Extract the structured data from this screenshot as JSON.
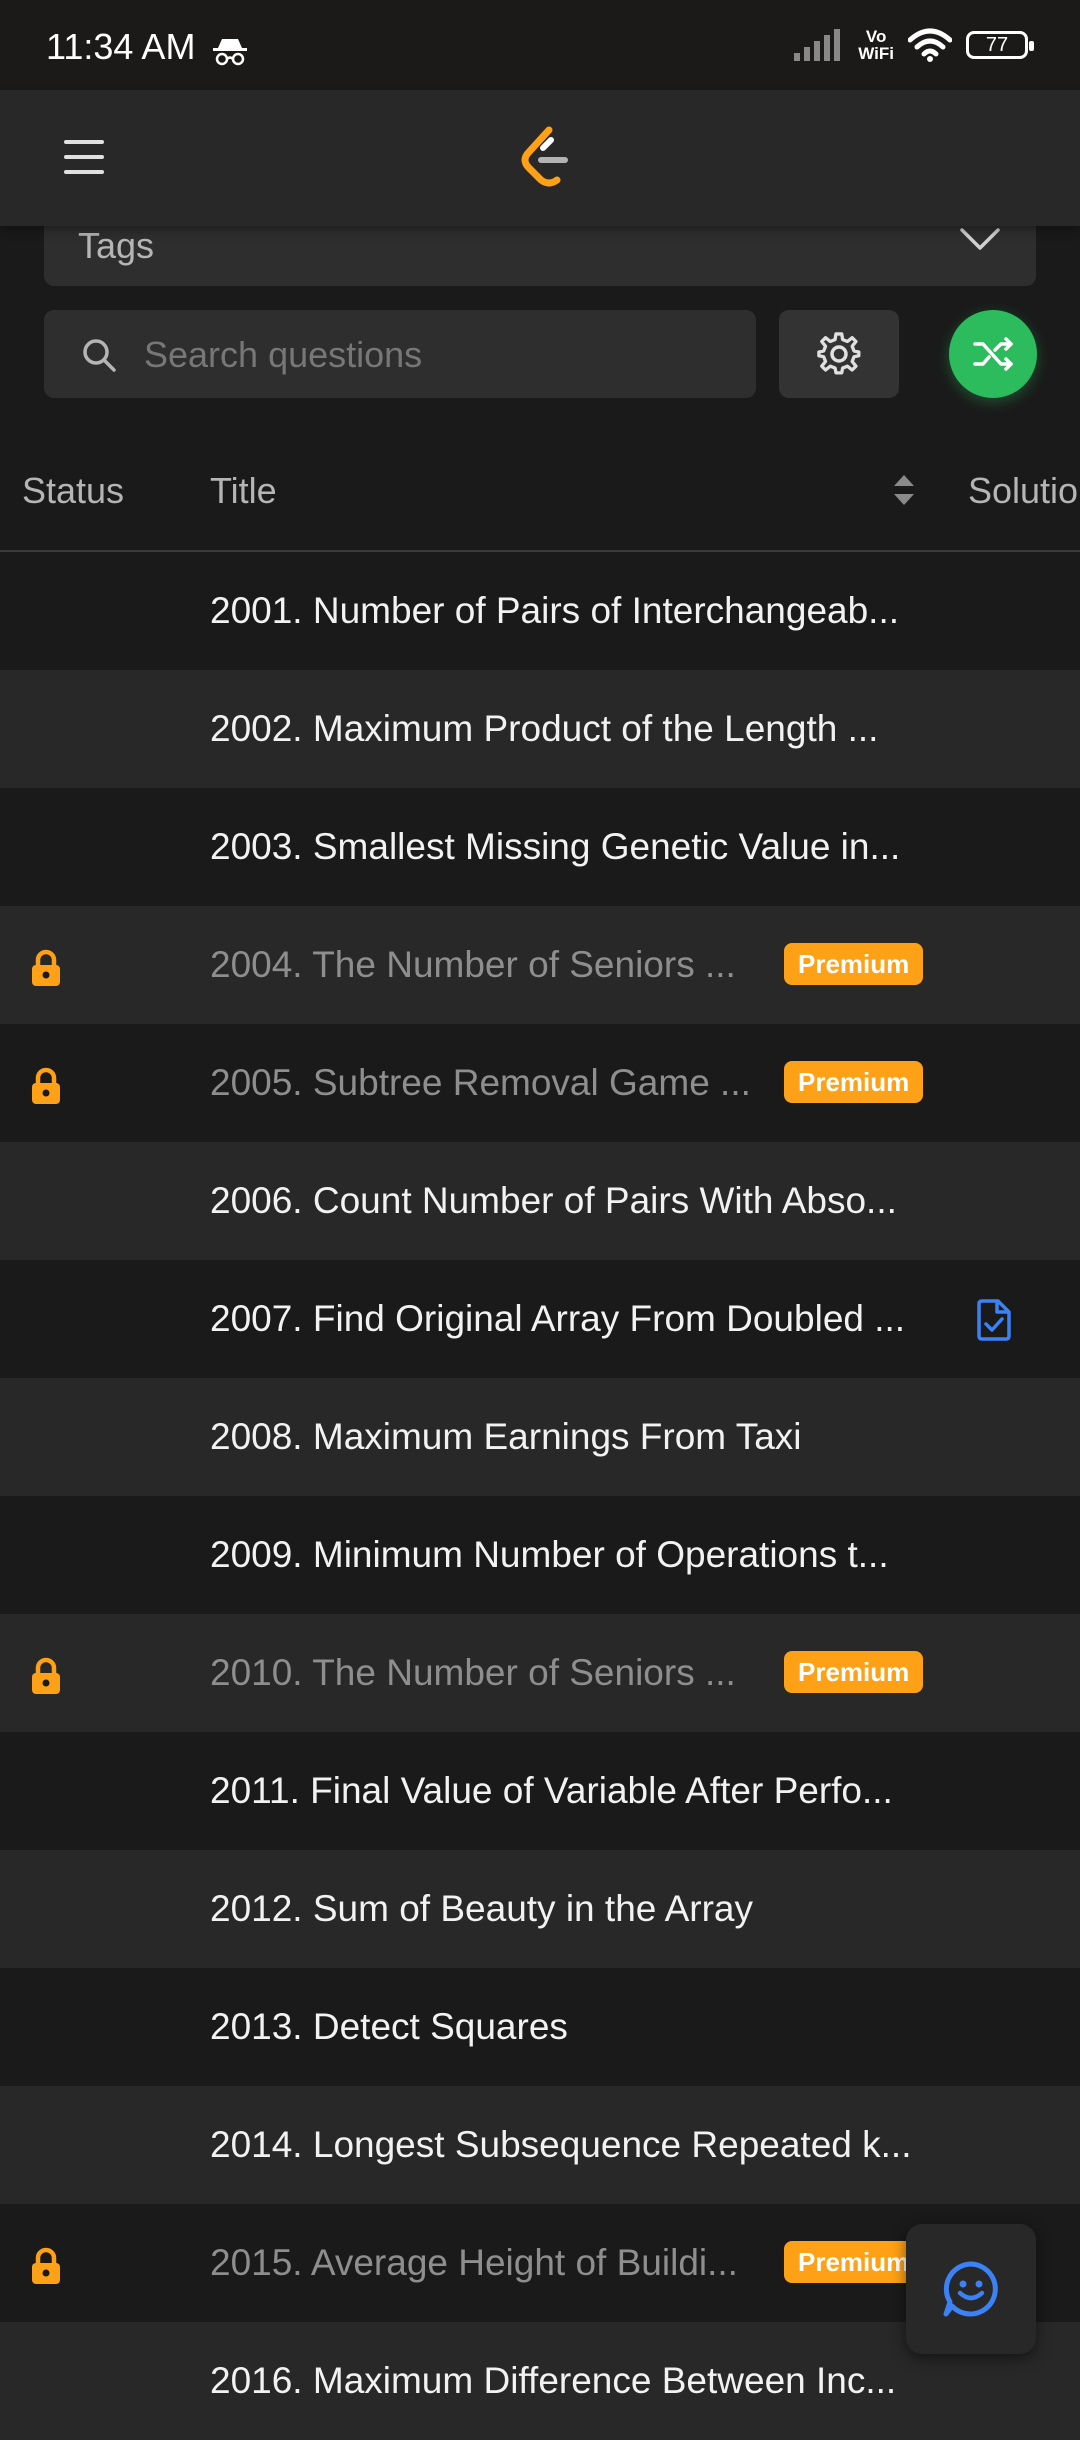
{
  "status_bar": {
    "time": "11:34 AM",
    "network_label_top": "Vo",
    "network_label_bottom": "WiFi",
    "battery": "77"
  },
  "filters": {
    "tags_label": "Tags",
    "search_placeholder": "Search questions"
  },
  "table": {
    "headers": {
      "status": "Status",
      "title": "Title",
      "solution": "Solution"
    },
    "premium_label": "Premium",
    "rows": [
      {
        "title": "2001. Number of Pairs of Interchangeab...",
        "locked": false,
        "premium": false,
        "solution": false
      },
      {
        "title": "2002. Maximum Product of the Length ...",
        "locked": false,
        "premium": false,
        "solution": false
      },
      {
        "title": "2003. Smallest Missing Genetic Value in...",
        "locked": false,
        "premium": false,
        "solution": false
      },
      {
        "title": "2004. The Number of Seniors ...",
        "locked": true,
        "premium": true,
        "solution": false
      },
      {
        "title": "2005. Subtree Removal Game ...",
        "locked": true,
        "premium": true,
        "solution": false
      },
      {
        "title": "2006. Count Number of Pairs With Abso...",
        "locked": false,
        "premium": false,
        "solution": false
      },
      {
        "title": "2007. Find Original Array From Doubled ...",
        "locked": false,
        "premium": false,
        "solution": true
      },
      {
        "title": "2008. Maximum Earnings From Taxi",
        "locked": false,
        "premium": false,
        "solution": false
      },
      {
        "title": "2009. Minimum Number of Operations t...",
        "locked": false,
        "premium": false,
        "solution": false
      },
      {
        "title": "2010. The Number of Seniors ...",
        "locked": true,
        "premium": true,
        "solution": false
      },
      {
        "title": "2011. Final Value of Variable After Perfo...",
        "locked": false,
        "premium": false,
        "solution": false
      },
      {
        "title": "2012. Sum of Beauty in the Array",
        "locked": false,
        "premium": false,
        "solution": false
      },
      {
        "title": "2013. Detect Squares",
        "locked": false,
        "premium": false,
        "solution": false
      },
      {
        "title": "2014. Longest Subsequence Repeated k...",
        "locked": false,
        "premium": false,
        "solution": false
      },
      {
        "title": "2015. Average Height of Buildi...",
        "locked": true,
        "premium": true,
        "solution": false
      },
      {
        "title": "2016. Maximum Difference Between Inc...",
        "locked": false,
        "premium": false,
        "solution": false
      }
    ]
  },
  "icons": {
    "menu": "hamburger-icon",
    "logo": "leetcode-logo-icon",
    "dropdown": "chevron-down-icon",
    "search": "search-icon",
    "settings": "gear-icon",
    "random": "shuffle-icon",
    "sort": "sort-icon",
    "lock": "lock-icon",
    "solution": "solution-doc-icon",
    "feedback": "smiley-chat-icon"
  },
  "colors": {
    "background": "#1a1a1a",
    "row_alt": "#282828",
    "premium": "#ffa116",
    "shuffle": "#2cbb5d",
    "solution_icon": "#3b82f6",
    "feedback_icon": "#3b82f6"
  }
}
